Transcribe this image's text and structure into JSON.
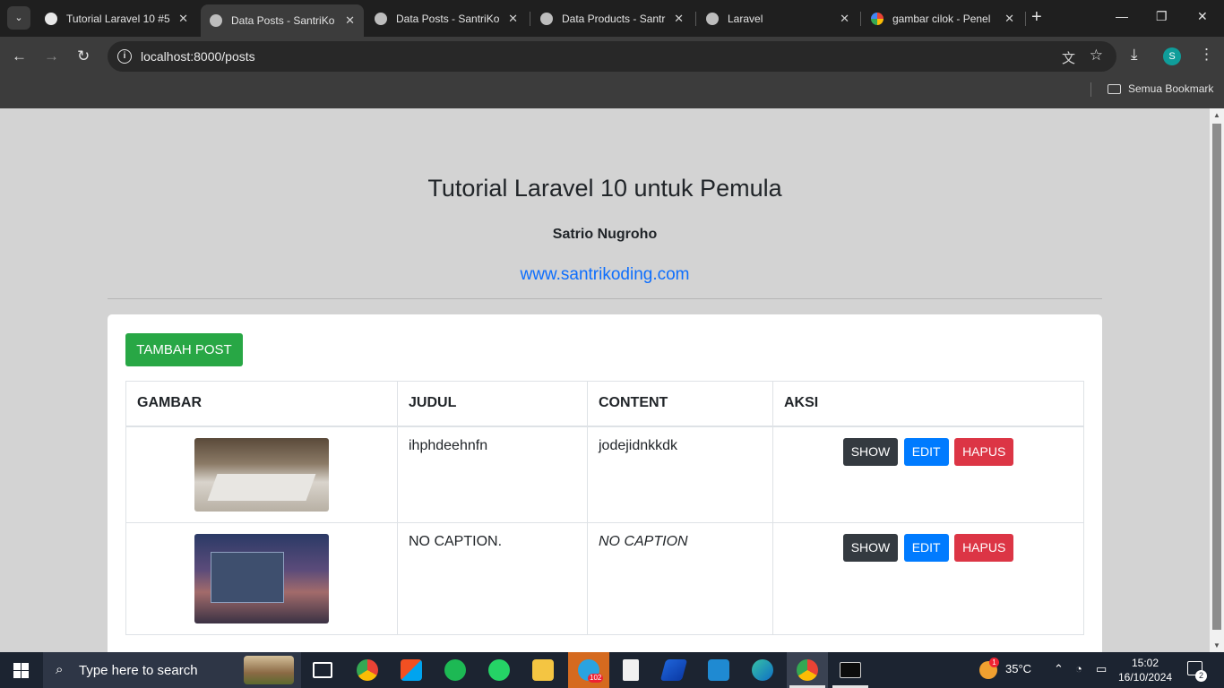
{
  "browser": {
    "tabs": [
      {
        "title": "Tutorial Laravel 10 #5",
        "favicon": "github-icon",
        "active": false
      },
      {
        "title": "Data Posts - SantriKo",
        "favicon": "globe-icon",
        "active": true
      },
      {
        "title": "Data Posts - SantriKo",
        "favicon": "globe-icon",
        "active": false
      },
      {
        "title": "Data Products - Santr",
        "favicon": "globe-icon",
        "active": false
      },
      {
        "title": "Laravel",
        "favicon": "globe-icon",
        "active": false
      },
      {
        "title": "gambar cilok - Penel",
        "favicon": "google-icon",
        "active": false
      }
    ],
    "url": "localhost:8000/posts",
    "profile_initial": "S",
    "bookmarks_label": "Semua Bookmark"
  },
  "page": {
    "title": "Tutorial Laravel 10 untuk Pemula",
    "author": "Satrio Nugroho",
    "link": "www.santrikoding.com",
    "add_button": "TAMBAH POST",
    "table": {
      "headers": [
        "GAMBAR",
        "JUDUL",
        "CONTENT",
        "AKSI"
      ],
      "rows": [
        {
          "title": "ihphdeehnfn",
          "content": "jodejidnkkdk"
        },
        {
          "title": "NO CAPTION.",
          "content": "NO CAPTION"
        }
      ],
      "actions": {
        "show": "SHOW",
        "edit": "EDIT",
        "delete": "HAPUS"
      }
    }
  },
  "taskbar": {
    "search_placeholder": "Type here to search",
    "temperature": "35°C",
    "time": "15:02",
    "date": "16/10/2024",
    "notifications": "2",
    "weather_badge": "1",
    "telegram_badge": "102"
  },
  "colors": {
    "success": "#28a745",
    "primary": "#007bff",
    "danger": "#dc3545",
    "dark": "#343a40",
    "link": "#0d6efd"
  }
}
